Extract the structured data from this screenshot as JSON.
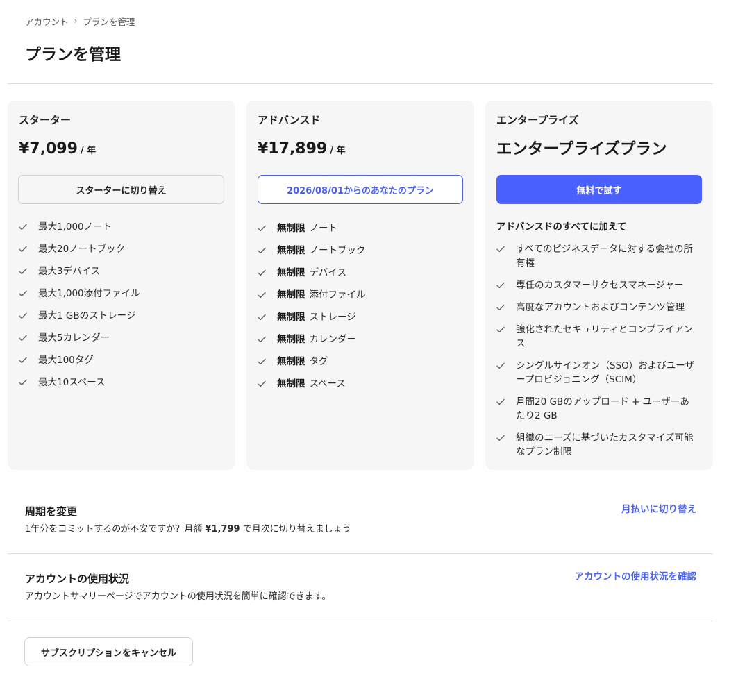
{
  "breadcrumb": {
    "items": [
      "アカウント",
      "プランを管理"
    ],
    "separator": "›"
  },
  "page_title": "プランを管理",
  "plans": [
    {
      "name": "スターター",
      "price": "¥7,099",
      "period": "/ 年",
      "button_label": "スターターに切り替え",
      "features": [
        "最大1,000ノート",
        "最大20ノートブック",
        "最大3デバイス",
        "最大1,000添付ファイル",
        "最大1 GBのストレージ",
        "最大5カレンダー",
        "最大100タグ",
        "最大10スペース"
      ]
    },
    {
      "name": "アドバンスド",
      "price": "¥17,899",
      "period": "/ 年",
      "button_label": "2026/08/01からのあなたのプラン",
      "feature_prefix": "無制限",
      "features": [
        "ノート",
        "ノートブック",
        "デバイス",
        "添付ファイル",
        "ストレージ",
        "カレンダー",
        "タグ",
        "スペース"
      ]
    },
    {
      "name": "エンタープライズ",
      "price": "エンタープライズプラン",
      "button_label": "無料で試す",
      "addon_title": "アドバンスドのすべてに加えて",
      "features": [
        "すべてのビジネスデータに対する会社の所有権",
        "専任のカスタマーサクセスマネージャー",
        "高度なアカウントおよびコンテンツ管理",
        "強化されたセキュリティとコンプライアンス",
        "シングルサインオン（SSO）およびユーザープロビジョニング（SCIM）",
        "月間20 GBのアップロード + ユーザーあたり2 GB",
        "組織のニーズに基づいたカスタマイズ可能なプラン制限"
      ]
    }
  ],
  "billing_cycle": {
    "title": "周期を変更",
    "desc_before": "1年分をコミットするのが不安ですか？月額 ",
    "desc_price": "¥1,799",
    "desc_after": " で月次に切り替えましょう",
    "link": "月払いに切り替え"
  },
  "usage": {
    "title": "アカウントの使用状況",
    "desc": "アカウントサマリーページでアカウントの使用状況を簡単に確認できます。",
    "link": "アカウントの使用状況を確認"
  },
  "cancel_button": "サブスクリプションをキャンセル",
  "colors": {
    "accent": "#4a61ff",
    "card_bg": "#f6f6f6",
    "divider": "#dedede"
  },
  "icons": {
    "feature": "checkmark-icon",
    "breadcrumb_separator": "chevron-right-icon"
  }
}
